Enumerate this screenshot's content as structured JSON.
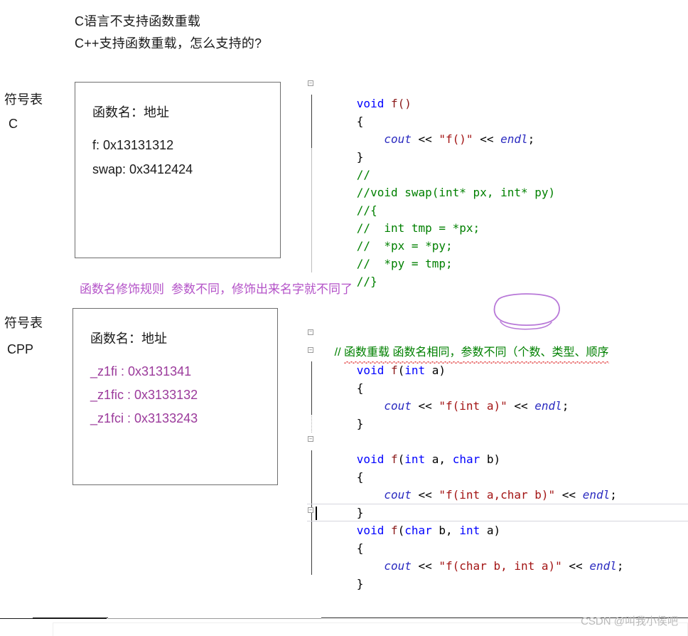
{
  "headings": {
    "line1": "C语言不支持函数重载",
    "line2": "C++支持函数重载，怎么支持的?"
  },
  "symbol_tables": [
    {
      "label_line1": "符号表",
      "label_line2": "C",
      "header": "函数名：地址",
      "entries": [
        "f:  0x13131312",
        "swap: 0x3412424"
      ]
    },
    {
      "label_line1": "符号表",
      "label_line2": "CPP",
      "header": "函数名：地址",
      "entries": [
        "_z1fi : 0x3131341",
        "_z1fic : 0x3133132",
        "_z1fci : 0x3133243"
      ]
    }
  ],
  "annotation": {
    "rule_text": "函数名修饰规则",
    "rule_detail": "参数不同，修饰出来名字就不同了",
    "circled_term": "参数不同",
    "ink_color": "#b453c8"
  },
  "code": {
    "comment_zh_prefix": "// ",
    "comment_zh_part1": "函数重载 函数名相同，",
    "comment_zh_part2": "参数不同",
    "comment_zh_part3": "（个数、类型、顺序",
    "lines": {
      "f_void_sig": "void f()",
      "open_brace": "{",
      "close_brace": "}",
      "cout": "cout",
      "shift": " << ",
      "endl": "endl",
      "semi": ";",
      "str_f_void": "\"f()\"",
      "str_f_int": "\"f(int a)\"",
      "str_f_int_char": "\"f(int a,char b)\"",
      "str_f_char_int": "\"f(char b, int a)\"",
      "f_int_sig_kw": "void ",
      "f_int_sig_name": "f(",
      "sig_int": "int",
      "sig_char": "char",
      "indent": "    "
    },
    "commented_swap": [
      "//",
      "//void swap(int* px, int* py)",
      "//{",
      "//  int tmp = *px;",
      "//  *px = *py;",
      "//  *py = tmp;",
      "//}"
    ],
    "signatures": {
      "f_void": {
        "ret": "void ",
        "name": "f",
        "params": "()"
      },
      "f_int": {
        "ret": "void ",
        "name": "f",
        "open": "(",
        "p1_type": "int",
        "p1_name": " a",
        "close": ")"
      },
      "f_int_char": {
        "ret": "void ",
        "name": "f",
        "open": "(",
        "p1_type": "int",
        "p1_name": " a, ",
        "p2_type": "char",
        "p2_name": " b",
        "close": ")"
      },
      "f_char_int": {
        "ret": "void ",
        "name": "f",
        "open": "(",
        "p1_type": "char",
        "p1_name": " b, ",
        "p2_type": "int",
        "p2_name": " a",
        "close": ")"
      }
    },
    "colors": {
      "keyword": "#0000ff",
      "function": "#8b1a1a",
      "string": "#a31515",
      "stream": "#2b2bc0",
      "comment": "#008000",
      "spellcheck": "#e23b3b"
    },
    "outline_glyph": "−"
  },
  "watermark": "CSDN @叫我小侯吧"
}
